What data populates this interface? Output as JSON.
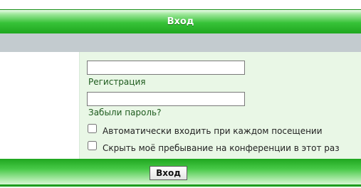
{
  "header": {
    "title": "Вход"
  },
  "form": {
    "username_value": "",
    "password_value": "",
    "register_link": "Регистрация",
    "forgot_link": "Забыли пароль?",
    "autologin_label": "Автоматически входить при каждом посещении",
    "hide_label": "Скрыть моё пребывание на конференции в этот раз",
    "autologin_checked": false,
    "hide_checked": false
  },
  "footer": {
    "submit_label": "Вход"
  },
  "colors": {
    "header_green": "#1fa71f",
    "grey_bar": "#c3cbcf",
    "panel_bg": "#e9f7e6",
    "link_green": "#1d5a1d"
  }
}
